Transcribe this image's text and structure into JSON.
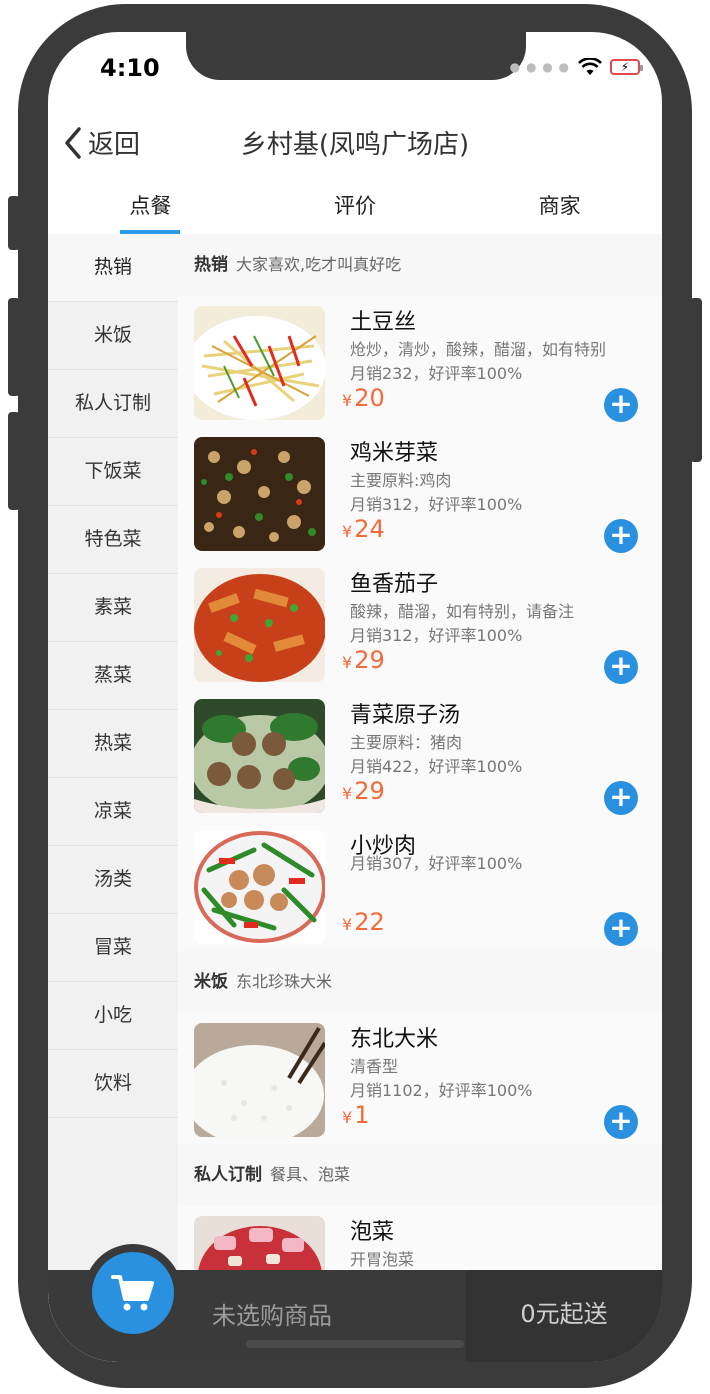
{
  "status_bar": {
    "time": "4:10"
  },
  "nav": {
    "back_label": "返回",
    "title": "乡村基(凤鸣广场店)"
  },
  "tabs": [
    {
      "label": "点餐",
      "active": true
    },
    {
      "label": "评价",
      "active": false
    },
    {
      "label": "商家",
      "active": false
    }
  ],
  "sidebar": {
    "items": [
      {
        "label": "热销"
      },
      {
        "label": "米饭"
      },
      {
        "label": "私人订制"
      },
      {
        "label": "下饭菜"
      },
      {
        "label": "特色菜"
      },
      {
        "label": "素菜"
      },
      {
        "label": "蒸菜"
      },
      {
        "label": "热菜"
      },
      {
        "label": "凉菜"
      },
      {
        "label": "汤类"
      },
      {
        "label": "冒菜"
      },
      {
        "label": "小吃"
      },
      {
        "label": "饮料"
      }
    ]
  },
  "sections": [
    {
      "name": "热销",
      "desc": "大家喜欢,吃才叫真好吃",
      "foods": [
        {
          "name": "土豆丝",
          "desc": "炝炒，清炒，酸辣，醋溜，如有特别",
          "sales": "月销232，好评率100%",
          "currency": "¥",
          "price": "20",
          "image": "potato-shreds"
        },
        {
          "name": "鸡米芽菜",
          "desc": "主要原料:鸡肉",
          "sales": "月销312，好评率100%",
          "currency": "¥",
          "price": "24",
          "image": "chicken-sprouts"
        },
        {
          "name": "鱼香茄子",
          "desc": "酸辣，醋溜，如有特别，请备注",
          "sales": "月销312，好评率100%",
          "currency": "¥",
          "price": "29",
          "image": "eggplant"
        },
        {
          "name": "青菜原子汤",
          "desc": "主要原料：猪肉",
          "sales": "月销422，好评率100%",
          "currency": "¥",
          "price": "29",
          "image": "meatball-soup"
        },
        {
          "name": "小炒肉",
          "desc": "",
          "sales": "月销307，好评率100%",
          "currency": "¥",
          "price": "22",
          "image": "stir-fry-pork"
        }
      ]
    },
    {
      "name": "米饭",
      "desc": "东北珍珠大米",
      "foods": [
        {
          "name": "东北大米",
          "desc": "清香型",
          "sales": "月销1102，好评率100%",
          "currency": "¥",
          "price": "1",
          "image": "rice"
        }
      ]
    },
    {
      "name": "私人订制",
      "desc": "餐具、泡菜",
      "foods": [
        {
          "name": "泡菜",
          "desc": "开胃泡菜",
          "sales": "",
          "currency": "",
          "price": "",
          "image": "pickles"
        }
      ]
    }
  ],
  "cart": {
    "empty_label": "未选购商品",
    "min_order_label": "0元起送"
  },
  "colors": {
    "accent": "#2a90e0",
    "price": "#f26a3a",
    "frame": "#3b3b3b"
  }
}
